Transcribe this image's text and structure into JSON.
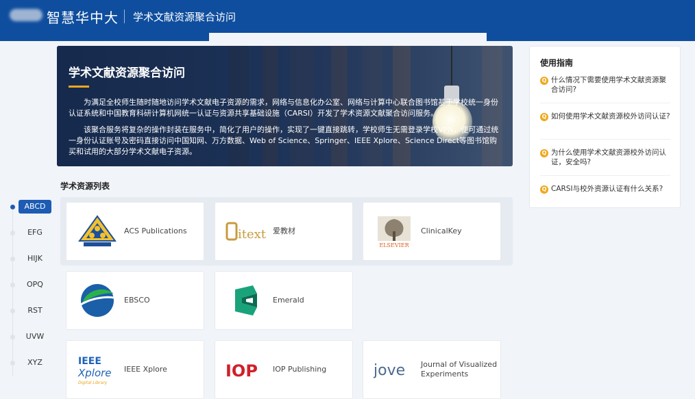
{
  "header": {
    "brand": "智慧华中大",
    "subtitle": "学术文献资源聚合访问"
  },
  "hero": {
    "title": "学术文献资源聚合访问",
    "p1": "为满足全校师生随时随地访问学术文献电子资源的需求，网络与信息化办公室、网络与计算中心联合图书馆基于学校统一身份认证系统和中国教育科研计算机网统一认证与资源共享基础设施（CARSI）开发了学术资源文献聚合访问服务。",
    "p2": "该聚合服务将复杂的操作封装在服务中，简化了用户的操作，实现了一键直接跳转，学校师生无需登录学校VPN，便可通过统一身份认证账号及密码直接访问中国知网、万方数据、Web of Science、Springer、IEEE Xplore、Science Direct等图书馆购买和试用的大部分学术文献电子资源。"
  },
  "resource_list_title": "学术资源列表",
  "alpha_nav": [
    "ABCD",
    "EFG",
    "HIJK",
    "OPQ",
    "RST",
    "UVW",
    "XYZ"
  ],
  "resources": [
    {
      "name": "ACS Publications",
      "logo": "acs-logo"
    },
    {
      "name": "爱教材",
      "logo": "itext-logo",
      "logo_text": "itext"
    },
    {
      "name": "ClinicalKey",
      "logo": "elsevier-logo",
      "logo_text": "ELSEVIER"
    },
    {
      "name": "EBSCO",
      "logo": "ebsco-logo"
    },
    {
      "name": "Emerald",
      "logo": "emerald-logo"
    },
    {
      "name": "IEEE Xplore",
      "logo": "ieee-xplore-logo",
      "logo_text": "IEEE",
      "logo_text2": "Xplore",
      "logo_text3": "Digital Library"
    },
    {
      "name": "IOP Publishing",
      "logo": "iop-logo",
      "logo_text": "IOP"
    },
    {
      "name": "Journal of Visualized Experiments",
      "logo": "jove-logo",
      "logo_text": "jove"
    }
  ],
  "guide": {
    "title": "使用指南",
    "items": [
      "什么情况下需要使用学术文献资源聚合访问?",
      "如何使用学术文献资源校外访问认证?",
      "为什么使用学术文献资源校外访问认证，安全吗?",
      "CARSI与校外资源认证有什么关系?"
    ],
    "q_icon": "Q"
  },
  "colors": {
    "primary": "#0f4e9e",
    "accent": "#f0a81c",
    "nav_active": "#1e5cb3"
  }
}
